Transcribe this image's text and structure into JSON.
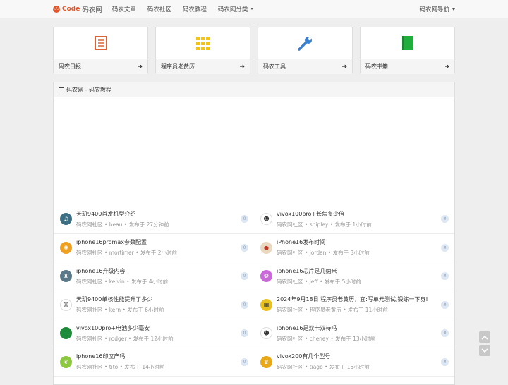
{
  "navbar": {
    "brand_code": "Code",
    "brand_name": "码农网",
    "links": [
      "码农文章",
      "码农社区",
      "码农教程",
      "码农网分类"
    ],
    "right_menu": "码农网导航"
  },
  "tiles": [
    {
      "label": "码农日报",
      "icon": "notebook-icon",
      "color": "#d9643a"
    },
    {
      "label": "程序员老黄历",
      "icon": "grid-icon",
      "color": "#f2c418"
    },
    {
      "label": "码农工具",
      "icon": "wrench-icon",
      "color": "#3b7fcf"
    },
    {
      "label": "码农书籍",
      "icon": "book-icon",
      "color": "#1fae3c"
    }
  ],
  "panel": {
    "title": "码农网 - 码农教程"
  },
  "items": [
    {
      "title": "天玑9400首发机型介绍",
      "meta": "码农网社区 • beau • 发布于 27分钟前",
      "badge": "0",
      "avatar_color": "#3c6f84",
      "avatar_icon": "music-icon"
    },
    {
      "title": "vivox100pro+长焦多少倍",
      "meta": "码农网社区 • shipley • 发布于 1小时前",
      "badge": "0",
      "avatar_color": "#ffffff",
      "avatar_icon": "person-icon"
    },
    {
      "title": "iphone16promax参数配置",
      "meta": "码农网社区 • mortimer • 发布于 2小时前",
      "badge": "0",
      "avatar_color": "#f0a020",
      "avatar_icon": "sun-icon"
    },
    {
      "title": "iPhone16发布时间",
      "meta": "码农网社区 • jordan • 发布于 3小时前",
      "badge": "0",
      "avatar_color": "#e8d8c0",
      "avatar_icon": "dot-icon"
    },
    {
      "title": "iphone16升级内容",
      "meta": "码农网社区 • kelvin • 发布于 4小时前",
      "badge": "0",
      "avatar_color": "#5a7888",
      "avatar_icon": "figure-icon"
    },
    {
      "title": "iphone16芯片是几纳米",
      "meta": "码农网社区 • jeff • 发布于 5小时前",
      "badge": "0",
      "avatar_color": "#c96ad8",
      "avatar_icon": "swirl-icon"
    },
    {
      "title": "天玑9400单核性能提升了多少",
      "meta": "码农网社区 • kern • 发布于 6小时前",
      "badge": "0",
      "avatar_color": "#ffffff",
      "avatar_icon": "face-icon"
    },
    {
      "title": "2024年9月18日 程序员老黄历，宜:写单元测试,锻练一下身!",
      "meta": "码农网社区 • 程序员老黄历 • 发布于 11小时前",
      "badge": "0",
      "avatar_color": "#e8c020",
      "avatar_icon": "calendar-icon"
    },
    {
      "title": "vivox100pro+电池多少毫安",
      "meta": "码农网社区 • rodger • 发布于 12小时前",
      "badge": "0",
      "avatar_color": "#1e8c3a",
      "avatar_icon": "circle-icon"
    },
    {
      "title": "iphone16是双卡双待吗",
      "meta": "码农网社区 • cheney • 发布于 13小时前",
      "badge": "0",
      "avatar_color": "#ffffff",
      "avatar_icon": "person-icon"
    },
    {
      "title": "iphone16印度产吗",
      "meta": "码农网社区 • tito • 发布于 14小时前",
      "badge": "0",
      "avatar_color": "#8cc840",
      "avatar_icon": "leaf-icon"
    },
    {
      "title": "vivox200有几个型号",
      "meta": "码农网社区 • tiago • 发布于 15小时前",
      "badge": "0",
      "avatar_color": "#e8a818",
      "avatar_icon": "trophy-icon"
    }
  ]
}
